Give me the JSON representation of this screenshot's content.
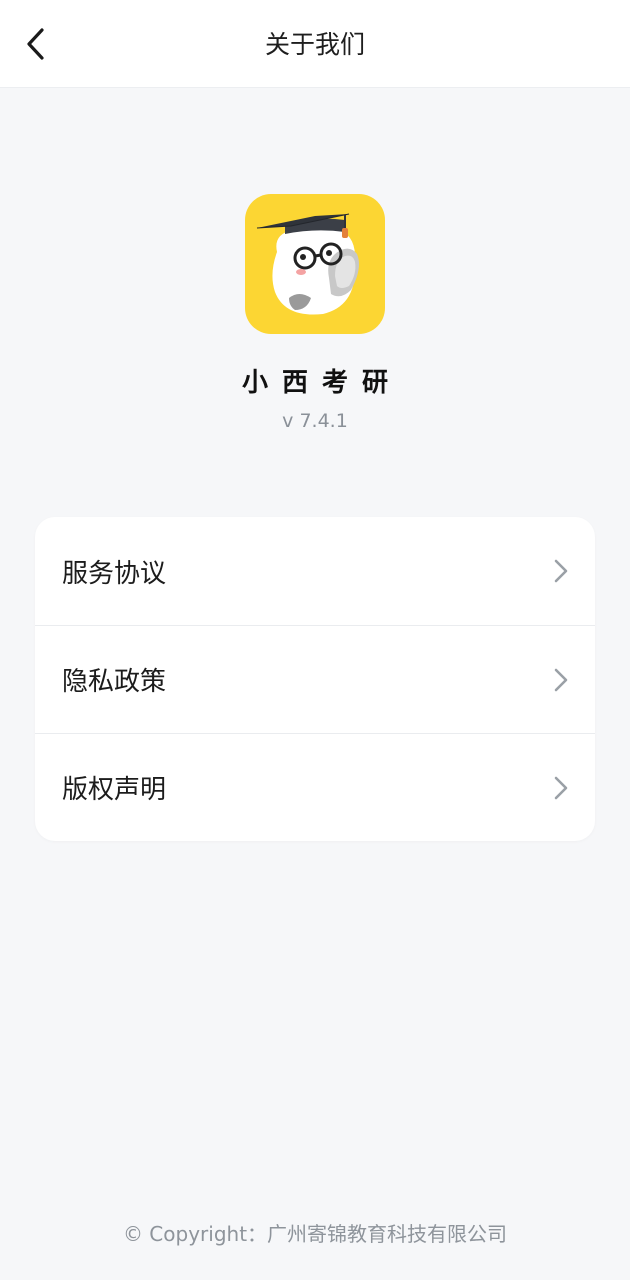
{
  "header": {
    "title": "关于我们",
    "back_icon": "chevron-left-icon"
  },
  "app": {
    "name": "小西考研",
    "version": "v 7.4.1",
    "logo_bg": "#fcd633"
  },
  "menu": {
    "items": [
      {
        "label": "服务协议",
        "icon": "chevron-right-icon"
      },
      {
        "label": "隐私政策",
        "icon": "chevron-right-icon"
      },
      {
        "label": "版权声明",
        "icon": "chevron-right-icon"
      }
    ]
  },
  "footer": {
    "copyright": "© Copyright：广州寄锦教育科技有限公司"
  },
  "colors": {
    "background": "#f6f7f9",
    "card": "#ffffff",
    "muted_text": "#8a9098"
  }
}
